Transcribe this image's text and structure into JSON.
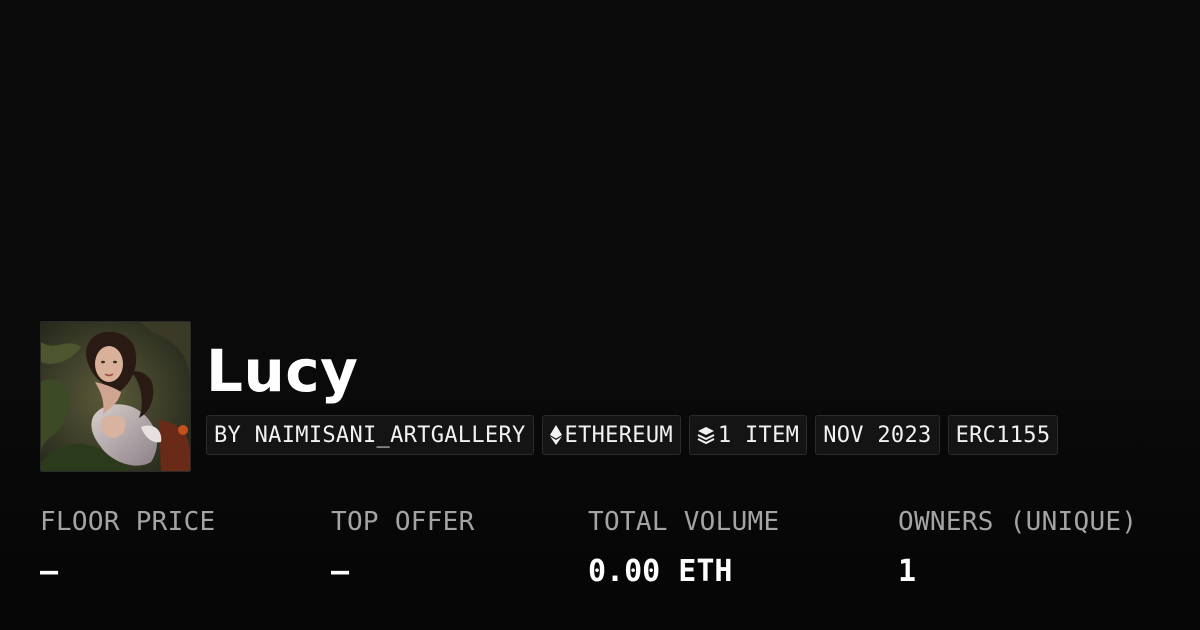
{
  "collection": {
    "title": "Lucy",
    "thumbnail_icon": "collection-artwork-image"
  },
  "tags": [
    {
      "label": "BY NAIMISANI_ARTGALLERY",
      "icon": ""
    },
    {
      "label": "ETHEREUM",
      "icon": "ethereum-icon"
    },
    {
      "label": "1 ITEM",
      "icon": "layers-icon"
    },
    {
      "label": "NOV 2023",
      "icon": ""
    },
    {
      "label": "ERC1155",
      "icon": ""
    }
  ],
  "stats": [
    {
      "label": "FLOOR PRICE",
      "value": "–"
    },
    {
      "label": "TOP OFFER",
      "value": "–"
    },
    {
      "label": "TOTAL VOLUME",
      "value": "0.00 ETH"
    },
    {
      "label": "OWNERS (UNIQUE)",
      "value": "1"
    }
  ],
  "colors": {
    "background": "#0a0a0a",
    "tag_background": "#141414",
    "tag_border": "#2b2b2b",
    "label_gray": "#a4a4a4",
    "text": "#ffffff"
  }
}
